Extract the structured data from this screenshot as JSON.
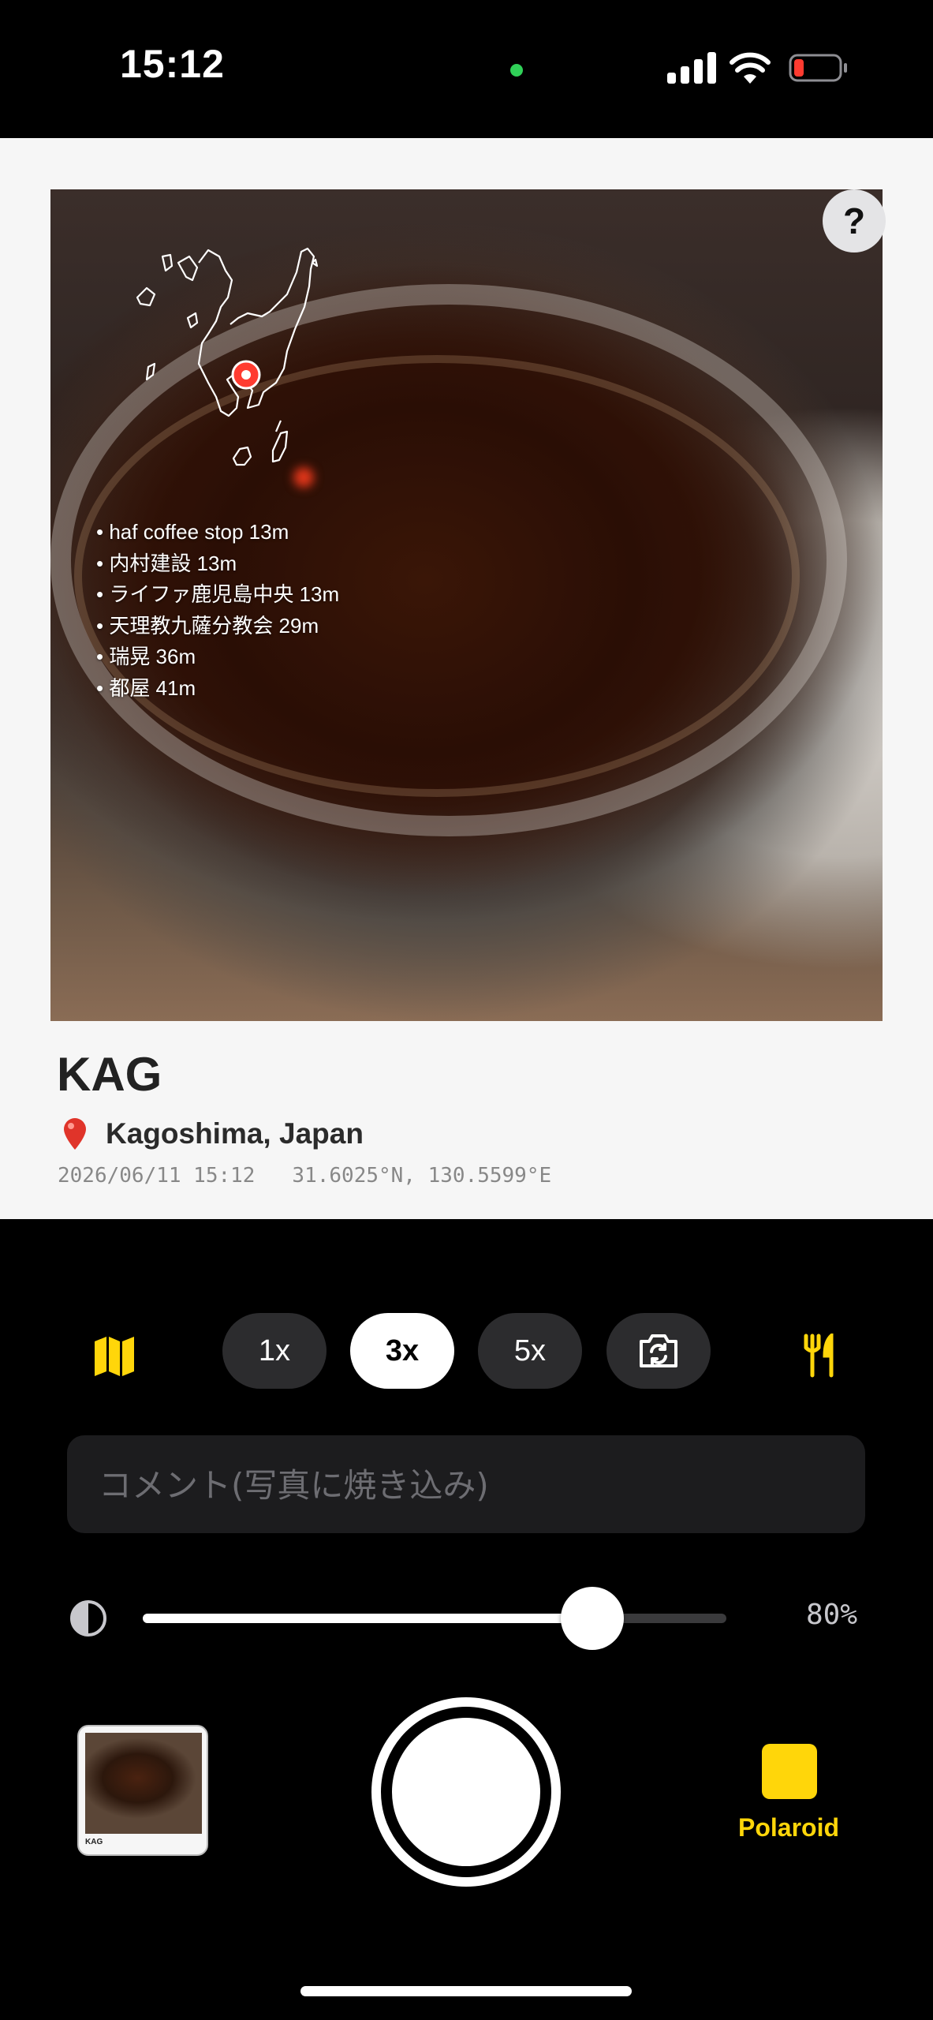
{
  "status_bar": {
    "time": "15:12"
  },
  "polaroid": {
    "help_label": "?",
    "nearby_places": [
      "haf coffee stop 13m",
      "内村建設 13m",
      "ライファ鹿児島中央 13m",
      "天理教九薩分教会 29m",
      "瑞晃 36m",
      "都屋 41m"
    ],
    "title": "KAG",
    "location": "Kagoshima, Japan",
    "datetime": "2026/06/11 15:12",
    "coordinates": "31.6025°N, 130.5599°E"
  },
  "controls": {
    "zoom_options": [
      "1x",
      "3x",
      "5x"
    ],
    "active_zoom": "3x",
    "comment_placeholder": "コメント(写真に焼き込み)",
    "contrast_percent": 80,
    "contrast_label": "80%",
    "mode_label": "Polaroid",
    "thumbnail_label": "KAG"
  },
  "colors": {
    "accent": "#ffd60a",
    "background": "#000000",
    "card": "#f6f6f6"
  },
  "icons": [
    "map-icon",
    "fork-knife-icon",
    "camera-flip-icon",
    "contrast-icon",
    "location-pin-icon",
    "help-icon"
  ]
}
